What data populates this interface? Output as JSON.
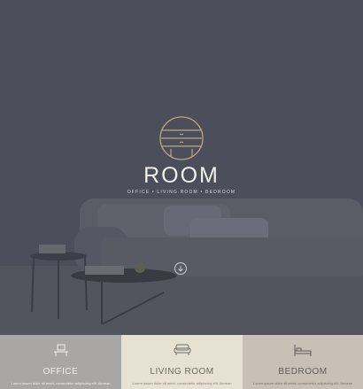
{
  "hero": {
    "brand": "ROOM",
    "subtitle": "OFFICE • LIVING ROOM • BEDROOM"
  },
  "categories": [
    {
      "title": "OFFICE",
      "text": "Lorem ipsum dolor sit amet, consectetur adipiscing elit. Aenean",
      "bg": "#a9a6a6",
      "fg": "#f3f1ee",
      "icon": "desk-icon"
    },
    {
      "title": "LIVING ROOM",
      "text": "Lorem ipsum dolor sit amet, consectetur adipiscing elit. Aenean",
      "bg": "#e6e1d2",
      "fg": "#6c6a64",
      "icon": "sofa-icon"
    },
    {
      "title": "BEDROOM",
      "text": "Lorem ipsum dolor sit amet, consectetur adipiscing elit. Aenean",
      "bg": "#c8c0b5",
      "fg": "#5f5b56",
      "icon": "bed-icon"
    }
  ],
  "colors": {
    "overlay": "#4c4e59",
    "accent": "#b9a78a"
  },
  "icons": {
    "logo": "round-cabinet-logo",
    "scroll": "arrow-down-circle-icon"
  }
}
